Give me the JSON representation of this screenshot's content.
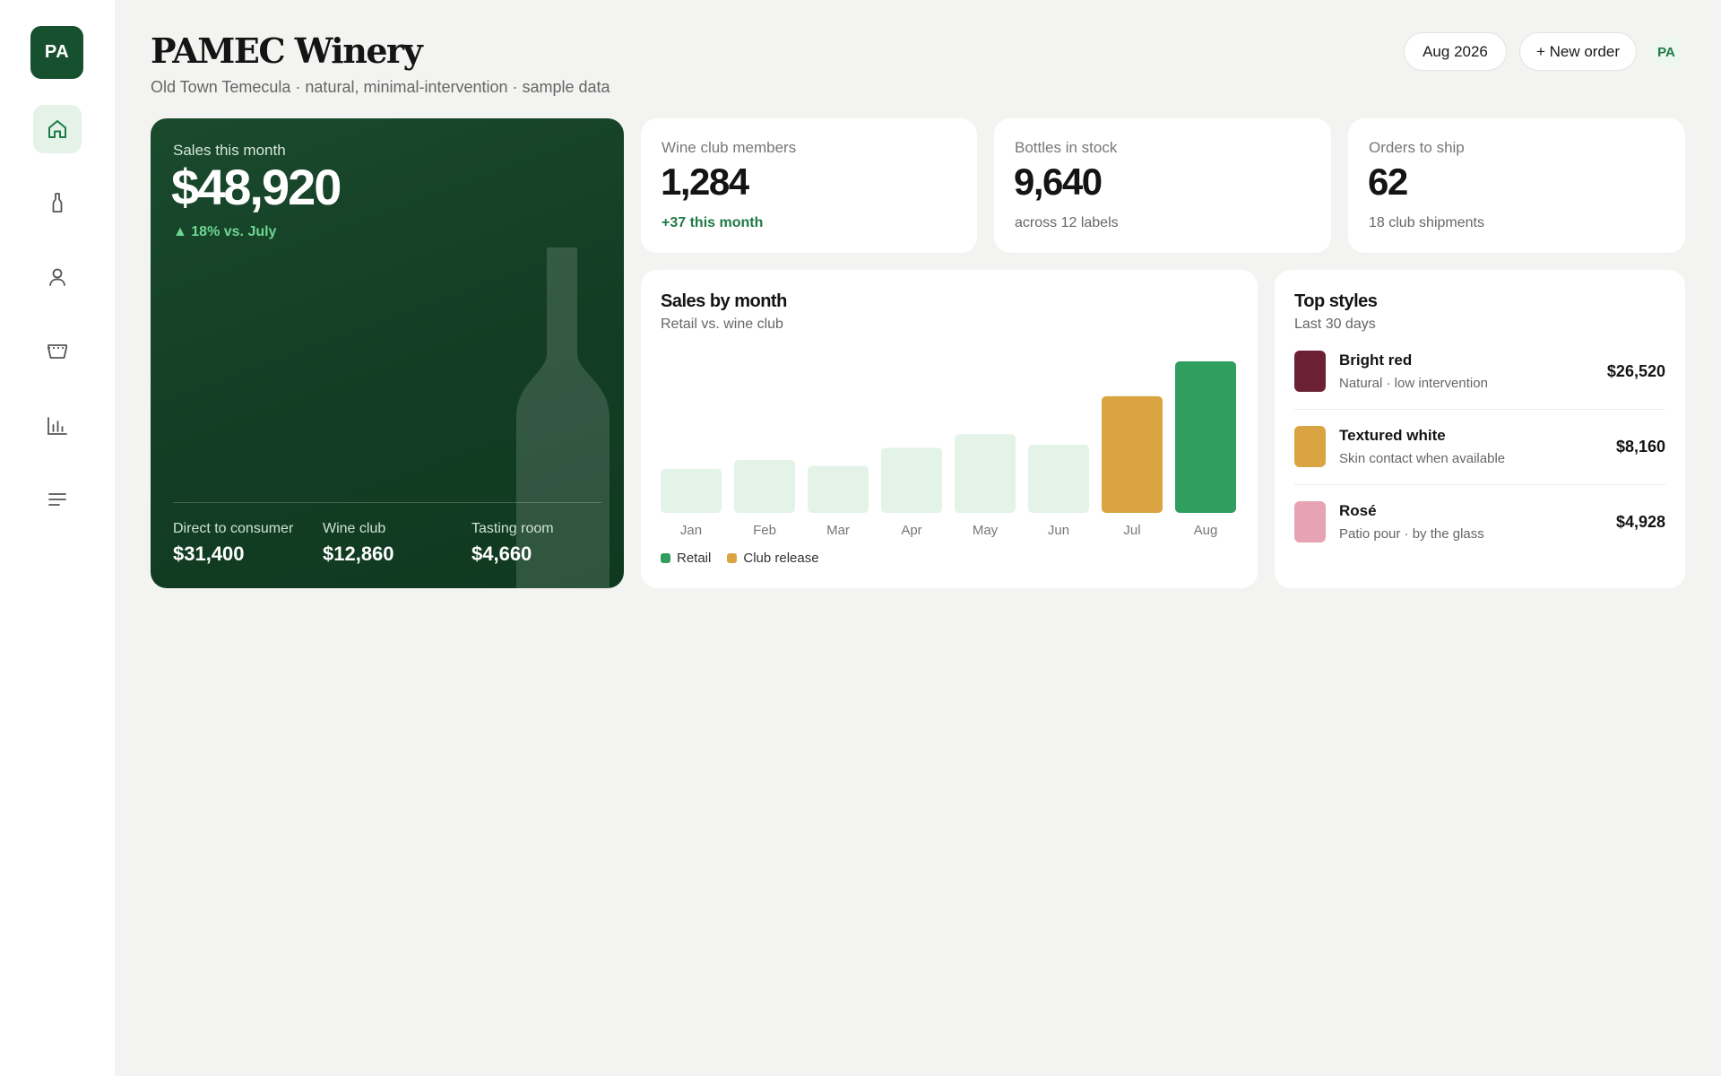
{
  "sidebar": {
    "logo": "PA",
    "items": [
      {
        "name": "home",
        "icon": "home-icon",
        "active": true
      },
      {
        "name": "wines",
        "icon": "bottle-icon",
        "active": false
      },
      {
        "name": "members",
        "icon": "user-icon",
        "active": false
      },
      {
        "name": "orders",
        "icon": "basket-icon",
        "active": false
      },
      {
        "name": "reports",
        "icon": "bar-chart-icon",
        "active": false
      },
      {
        "name": "menu",
        "icon": "menu-icon",
        "active": false
      }
    ]
  },
  "header": {
    "title": "PAMEC Winery",
    "subtitle": "Old Town Temecula · natural, minimal-intervention · sample data",
    "month_button": "Aug 2026",
    "new_order_button": "+ New order",
    "avatar": "PA"
  },
  "hero": {
    "label": "Sales this month",
    "value": "$48,920",
    "delta": "▲ 18% vs. July",
    "stats": [
      {
        "label": "Direct to consumer",
        "value": "$31,400"
      },
      {
        "label": "Wine club",
        "value": "$12,860"
      },
      {
        "label": "Tasting room",
        "value": "$4,660"
      }
    ]
  },
  "kpis": [
    {
      "label": "Wine club members",
      "value": "1,284",
      "sub": "+37 this month"
    },
    {
      "label": "Bottles in stock",
      "value": "9,640",
      "sub": "across 12 labels"
    },
    {
      "label": "Orders to ship",
      "value": "62",
      "sub": "18 club shipments"
    }
  ],
  "sales_chart": {
    "title": "Sales by month",
    "subtitle": "Retail vs. wine club",
    "legend": [
      {
        "name": "Retail",
        "color": "#2f9e5e"
      },
      {
        "name": "Club release",
        "color": "#d9a441"
      }
    ]
  },
  "chart_data": {
    "type": "bar",
    "categories": [
      "Jan",
      "Feb",
      "Mar",
      "Apr",
      "May",
      "Jun",
      "Jul",
      "Aug"
    ],
    "values": [
      29,
      35,
      31,
      43,
      52,
      45,
      77,
      100
    ],
    "highlight": {
      "Jul": "Club release",
      "Aug": "Retail"
    },
    "colors": {
      "default": "#e3f3e8",
      "Jul": "#d9a441",
      "Aug": "#2f9e5e"
    },
    "ylim": [
      0,
      100
    ],
    "grid": false,
    "legend_position": "bottom-left"
  },
  "top_styles": {
    "title": "Top styles",
    "subtitle": "Last 30 days",
    "items": [
      {
        "name": "Bright red",
        "desc": "Natural · low intervention",
        "amount": "$26,520",
        "color": "#6b2133"
      },
      {
        "name": "Textured white",
        "desc": "Skin contact when available",
        "amount": "$8,160",
        "color": "#d9a441"
      },
      {
        "name": "Rosé",
        "desc": "Patio pour · by the glass",
        "amount": "$4,928",
        "color": "#e5a3b3"
      }
    ]
  }
}
